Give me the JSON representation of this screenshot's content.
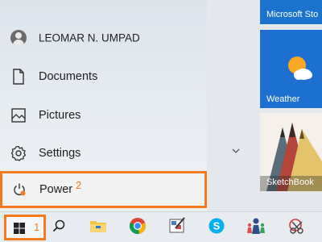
{
  "user": {
    "name": "LEOMAR N. UMPAD"
  },
  "menu": {
    "documents": "Documents",
    "pictures": "Pictures",
    "settings": "Settings",
    "power": "Power"
  },
  "tiles": {
    "microsoft_store": "Microsoft Sto",
    "weather": "Weather",
    "sketchbook": "SketchBook"
  },
  "annotations": {
    "step1": "1",
    "step2": "2",
    "highlight_color": "#f47a20"
  },
  "taskbar": {
    "icons": [
      "windows-start-icon",
      "search-icon",
      "file-explorer-icon",
      "chrome-icon",
      "paint-app-icon",
      "skype-icon",
      "meeting-app-icon",
      "snipping-tool-icon"
    ]
  }
}
